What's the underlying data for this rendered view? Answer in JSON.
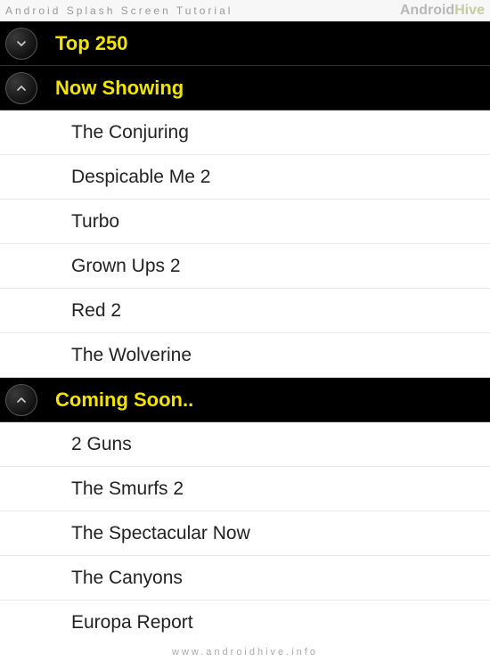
{
  "header": {
    "title": "Android Splash Screen Tutorial",
    "brand_prefix": "Android",
    "brand_suffix": "Hive"
  },
  "groups": [
    {
      "title": "Top 250",
      "expanded": false,
      "items": []
    },
    {
      "title": "Now Showing",
      "expanded": true,
      "items": [
        "The Conjuring",
        "Despicable Me 2",
        "Turbo",
        "Grown Ups 2",
        "Red 2",
        "The Wolverine"
      ]
    },
    {
      "title": "Coming Soon..",
      "expanded": true,
      "items": [
        "2 Guns",
        "The Smurfs 2",
        "The Spectacular Now",
        "The Canyons",
        "Europa Report"
      ]
    }
  ],
  "footer": {
    "url": "www.androidhive.info"
  }
}
